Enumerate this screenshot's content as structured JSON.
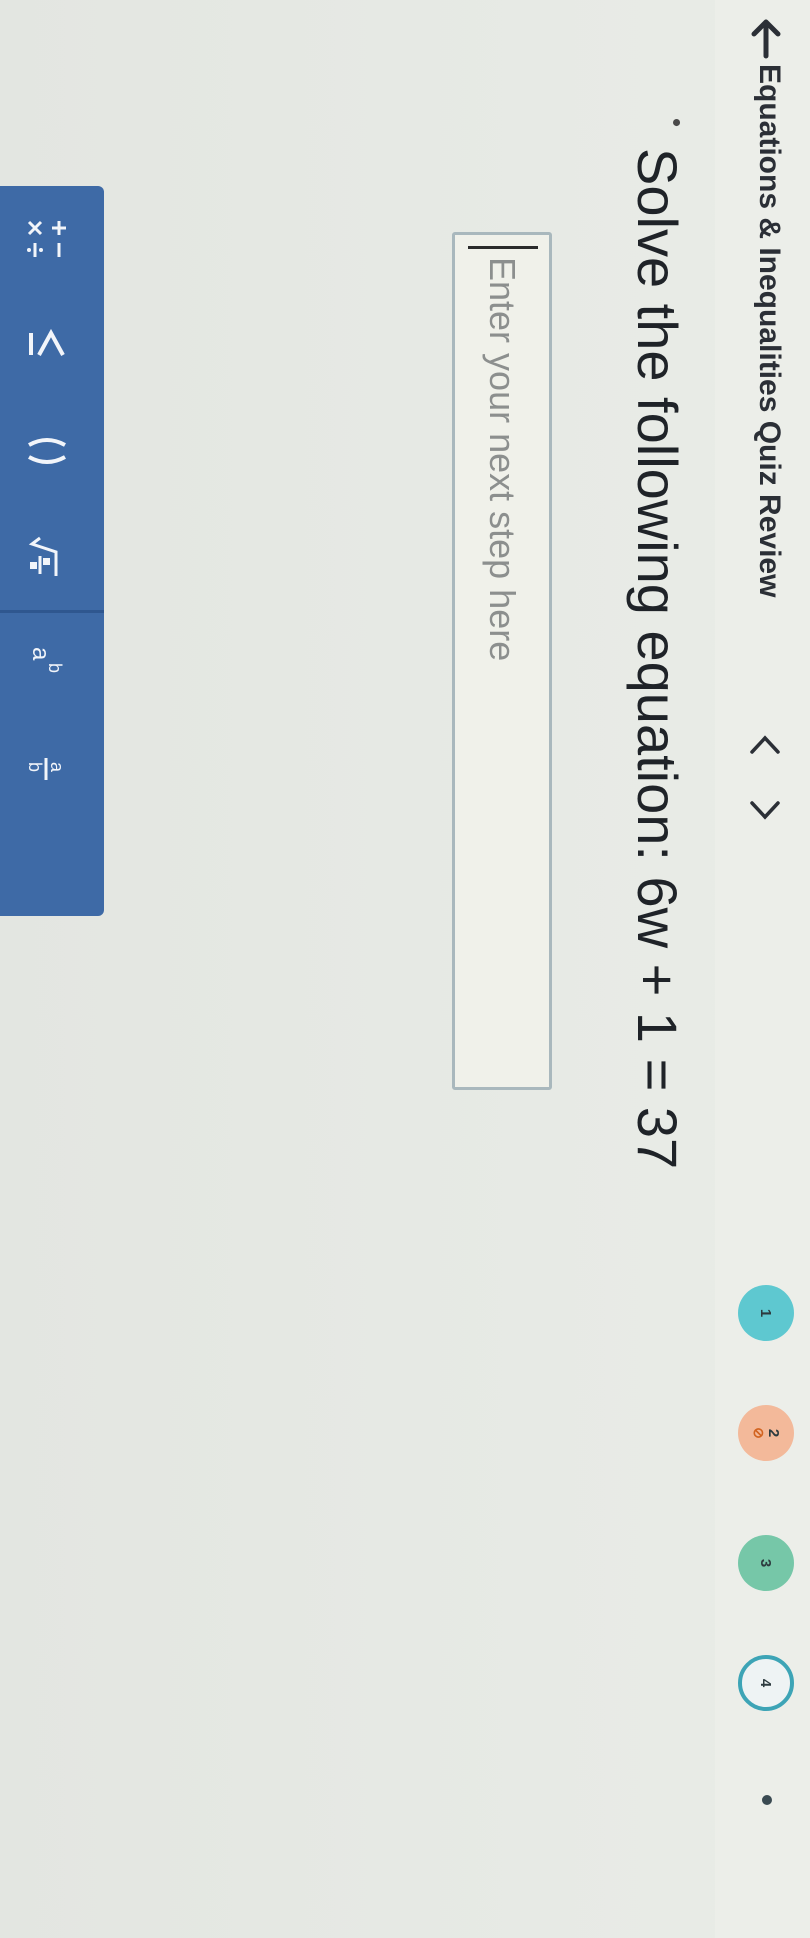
{
  "header": {
    "title": "Equations & Inequalities Quiz Review",
    "steps": [
      {
        "label": "1",
        "state": "done",
        "color": "#5ec8d0"
      },
      {
        "label": "2",
        "state": "incorrect",
        "color": "#f3b99a"
      },
      {
        "label": "3",
        "state": "done",
        "color": "#76c7a8"
      },
      {
        "label": "4",
        "state": "current",
        "color": "#3da4b6"
      }
    ]
  },
  "question": {
    "prompt": "Solve the following equation: 6w + 1 = 37"
  },
  "answer": {
    "placeholder": "Enter your next step here",
    "value": ""
  },
  "toolbar": {
    "buttons": [
      {
        "icon": "plus-minus-times-divide-icon"
      },
      {
        "icon": "less-greater-equal-icon"
      },
      {
        "icon": "parentheses-icon"
      },
      {
        "icon": "fraction-square-root-icon"
      },
      {
        "icon": "exponent-icon"
      },
      {
        "icon": "fraction-icon"
      }
    ],
    "color": "#3e6aa6"
  }
}
